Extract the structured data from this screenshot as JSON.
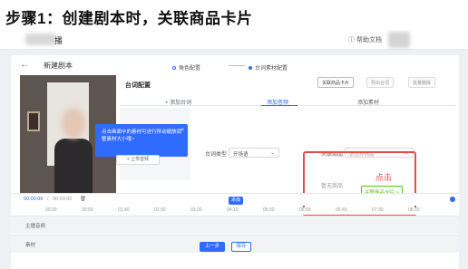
{
  "step_title": "步骤1：创建剧本时，关联商品卡片",
  "topbar": {
    "app_title": "播",
    "help": "帮助文档"
  },
  "page": {
    "back_icon": "←",
    "title": "新建剧本"
  },
  "steps": [
    {
      "label": "角色配置",
      "active": false
    },
    {
      "label": "台词素材配置",
      "active": true
    }
  ],
  "video_tooltip": {
    "text": "点击画面中的素材可进行移动缩放调整素材大小哦~",
    "close": "×"
  },
  "panel": {
    "title": "台词配置",
    "toolbar": [
      "关联商品卡片",
      "导出台词",
      "批量删除"
    ],
    "tabs": [
      "+ 添加台词",
      "添加音频",
      "添加素材"
    ],
    "line_type_label": "台词类型",
    "line_type_value": "开场语",
    "related_goods_label": "关联商品",
    "related_goods_placeholder": "请选择商品",
    "upload_audio": "+ 上传音频",
    "selected_goods_label": "暂无商品",
    "selected_goods_button": "关联商品卡片 >"
  },
  "annotation": {
    "click_label": "点击"
  },
  "timeline": {
    "time_current": "00:00:00",
    "time_total": "00:00:00",
    "track_button": "添加",
    "ticks": [
      "00:00",
      "00:50",
      "01:40",
      "02:30",
      "03:20",
      "04:10",
      "05:00",
      "05:50",
      "06:40",
      "07:30",
      "08:20"
    ],
    "tracks": [
      "主播音频",
      "素材"
    ]
  },
  "footer": {
    "prev_button": "上一步",
    "save_button": "保存"
  },
  "colors": {
    "accent": "#2f6bff",
    "annotation": "#e0504a",
    "success": "#52c41a"
  }
}
